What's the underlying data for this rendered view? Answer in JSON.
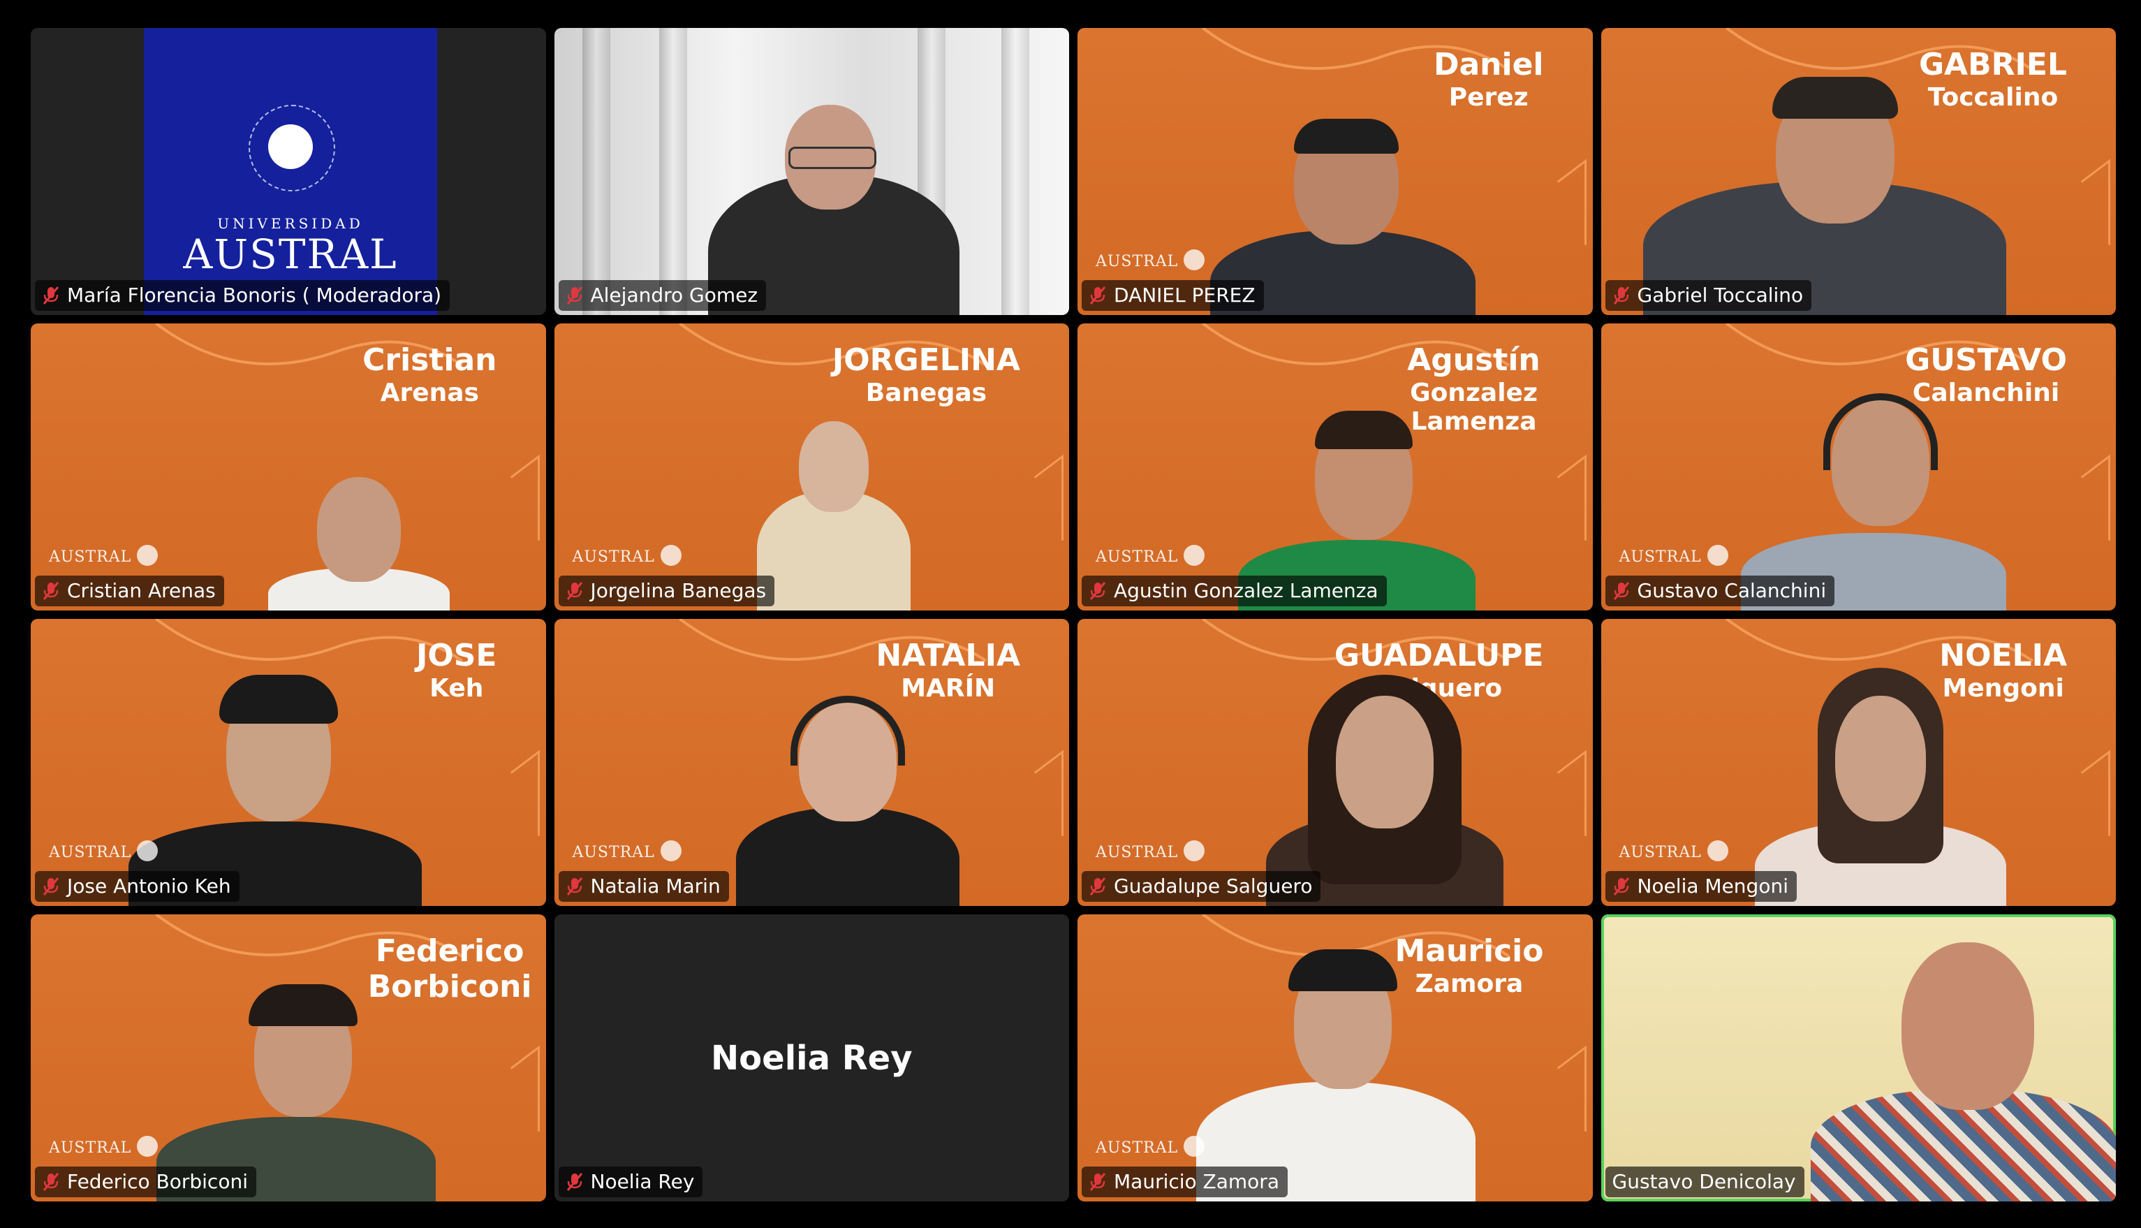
{
  "colors": {
    "orange_bg": "#D9702D",
    "dark_tile": "#232323",
    "active_speaker_border": "#59D35A",
    "austral_blue": "#14209C",
    "muted_icon_red": "#E0383E"
  },
  "meeting": {
    "tiles": [
      {
        "name": "María Florencia Bonoris ( Moderadora)",
        "muted": true,
        "bg": "logo"
      },
      {
        "name": "Alejandro Gomez",
        "muted": true,
        "bg": "room"
      },
      {
        "name": "DANIEL PEREZ",
        "muted": true,
        "bg": "orange",
        "bg_first": "Daniel",
        "bg_last": "Perez"
      },
      {
        "name": "Gabriel Toccalino",
        "muted": true,
        "bg": "orange",
        "bg_first": "GABRIEL",
        "bg_last": "Toccalino"
      },
      {
        "name": "Cristian Arenas",
        "muted": true,
        "bg": "orange",
        "bg_first": "Cristian",
        "bg_last": "Arenas"
      },
      {
        "name": "Jorgelina Banegas",
        "muted": true,
        "bg": "orange",
        "bg_first": "JORGELINA",
        "bg_last": "Banegas"
      },
      {
        "name": "Agustin Gonzalez Lamenza",
        "muted": true,
        "bg": "orange",
        "bg_first": "Agustín",
        "bg_last": "Gonzalez Lamenza"
      },
      {
        "name": "Gustavo Calanchini",
        "muted": true,
        "bg": "orange",
        "bg_first": "GUSTAVO",
        "bg_last": "Calanchini"
      },
      {
        "name": "Jose Antonio Keh",
        "muted": true,
        "bg": "orange",
        "bg_first": "JOSE",
        "bg_last": "Keh"
      },
      {
        "name": "Natalia Marin",
        "muted": true,
        "bg": "orange",
        "bg_first": "NATALIA",
        "bg_last": "MARÍN"
      },
      {
        "name": "Guadalupe Salguero",
        "muted": true,
        "bg": "orange",
        "bg_first": "GUADALUPE",
        "bg_last": "Salguero"
      },
      {
        "name": "Noelia Mengoni",
        "muted": true,
        "bg": "orange",
        "bg_first": "NOELIA",
        "bg_last": "Mengoni"
      },
      {
        "name": "Federico Borbiconi",
        "muted": true,
        "bg": "orange",
        "bg_first": "Federico",
        "bg_last": "Borbiconi"
      },
      {
        "name": "Noelia Rey",
        "muted": true,
        "bg": "dark",
        "center_name": "Noelia Rey"
      },
      {
        "name": "Mauricio Zamora",
        "muted": true,
        "bg": "orange",
        "bg_first": "Mauricio",
        "bg_last": "Zamora"
      },
      {
        "name": "Gustavo Denicolay",
        "muted": false,
        "bg": "light",
        "active_speaker": true
      }
    ]
  },
  "logo": {
    "universidad": "UNIVERSIDAD",
    "austral": "AUSTRAL",
    "small_austral": "AUSTRAL"
  }
}
